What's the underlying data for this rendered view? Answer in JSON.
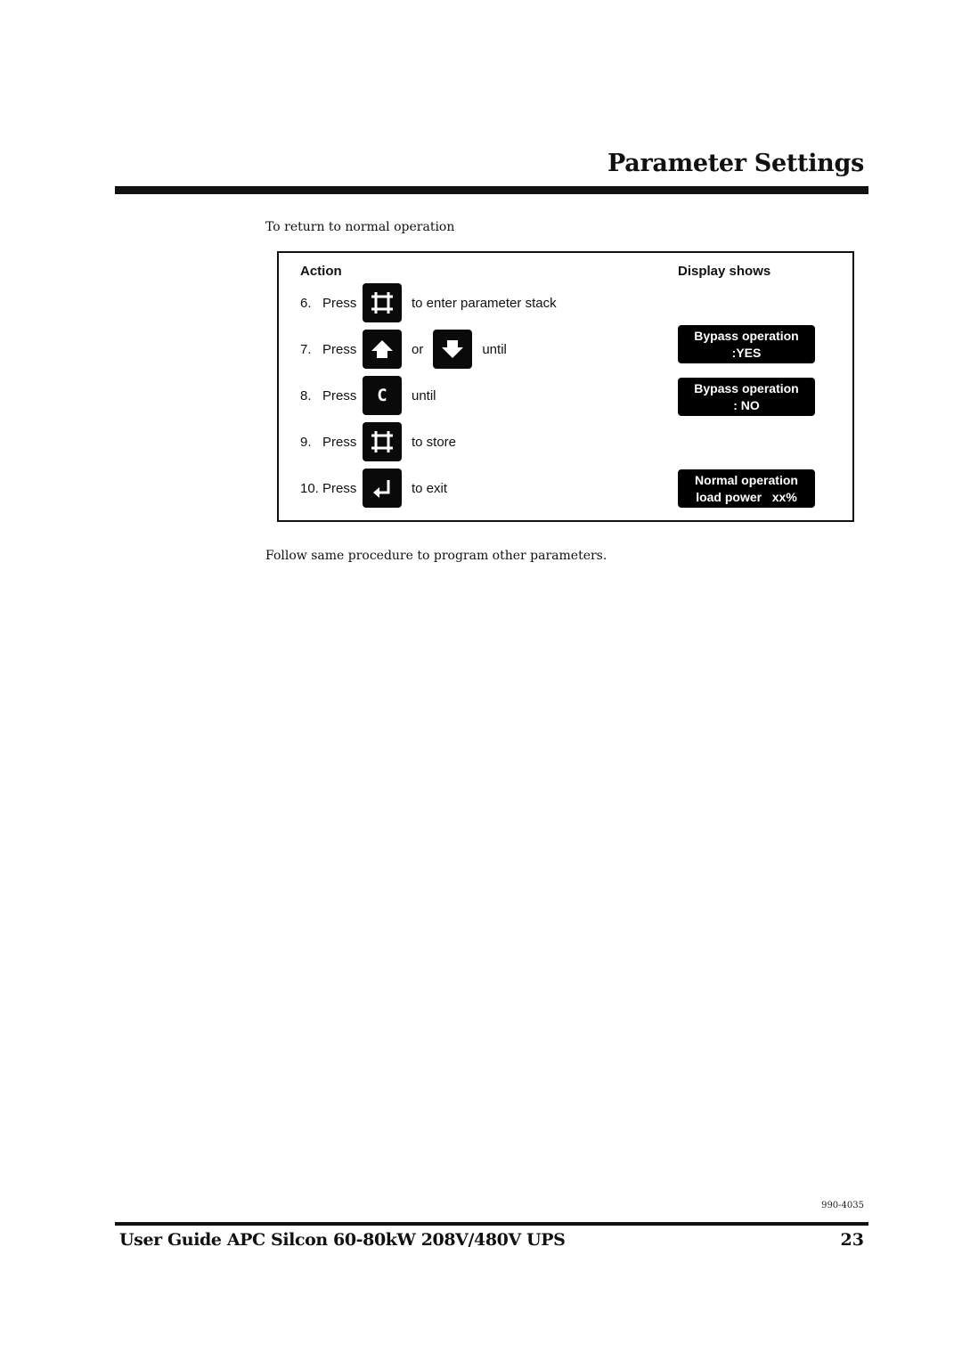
{
  "header": {
    "title": "Parameter Settings"
  },
  "intro_text": "To return to normal operation",
  "procedure": {
    "column_headers": {
      "action": "Action",
      "display": "Display shows"
    },
    "steps": [
      {
        "number": "6.",
        "verb": "Press",
        "keys": [
          "enter-stack-icon"
        ],
        "text": "to enter parameter stack"
      },
      {
        "number": "7.",
        "verb": "Press",
        "keys": [
          "arrow-up-icon",
          "arrow-down-icon"
        ],
        "connector": "or",
        "text": "until"
      },
      {
        "number": "8.",
        "verb": "Press",
        "keys": [
          "clear-c-icon"
        ],
        "key_label": "C",
        "text": "until"
      },
      {
        "number": "9.",
        "verb": "Press",
        "keys": [
          "enter-stack-icon"
        ],
        "text": "to store"
      },
      {
        "number": "10.",
        "verb": "Press",
        "keys": [
          "return-enter-icon"
        ],
        "text": "to exit"
      }
    ],
    "displays": [
      {
        "for_step": "7.",
        "line1": "Bypass operation",
        "line2": ":YES"
      },
      {
        "for_step": "8.",
        "line1": "Bypass operation",
        "line2": ": NO"
      },
      {
        "for_step": "10.",
        "line1": "Normal operation",
        "line2": "load power   xx%"
      }
    ]
  },
  "follow_text": "Follow same procedure to program other parameters.",
  "footer": {
    "doc_number": "990-4035",
    "title": "User Guide APC Silcon 60-80kW 208V/480V UPS",
    "page_number": "23"
  }
}
